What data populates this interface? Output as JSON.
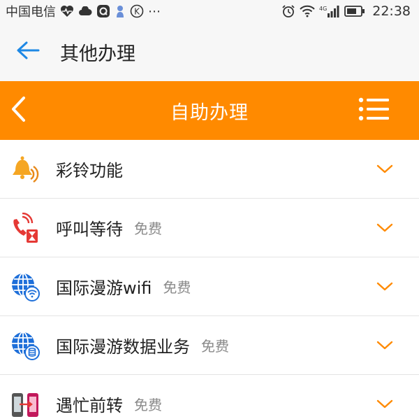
{
  "status_bar": {
    "carrier": "中国电信",
    "time": "22:38",
    "ellipsis": "⋯",
    "network": "4G",
    "icons": [
      "heart-pulse-icon",
      "cloud-icon",
      "q-app-icon",
      "baby-icon",
      "k-circle-icon",
      "alarm-icon",
      "wifi-icon",
      "signal-icon",
      "battery-icon"
    ]
  },
  "header": {
    "back_icon": "arrow-left-icon",
    "title": "其他办理"
  },
  "orange_bar": {
    "back_icon": "chevron-left-icon",
    "title": "自助办理",
    "menu_icon": "list-menu-icon"
  },
  "list": {
    "items": [
      {
        "label": "彩铃功能",
        "tag": "",
        "icon": "ringtone-bell-icon"
      },
      {
        "label": "呼叫等待",
        "tag": "免费",
        "icon": "call-waiting-icon"
      },
      {
        "label": "国际漫游wifi",
        "tag": "免费",
        "icon": "globe-wifi-icon"
      },
      {
        "label": "国际漫游数据业务",
        "tag": "免费",
        "icon": "globe-data-icon"
      },
      {
        "label": "遇忙前转",
        "tag": "免费",
        "icon": "call-forward-icon"
      }
    ]
  },
  "colors": {
    "accent_orange": "#ff8a00",
    "back_arrow_blue": "#1e88e5",
    "tag_gray": "#8a8a8a"
  }
}
